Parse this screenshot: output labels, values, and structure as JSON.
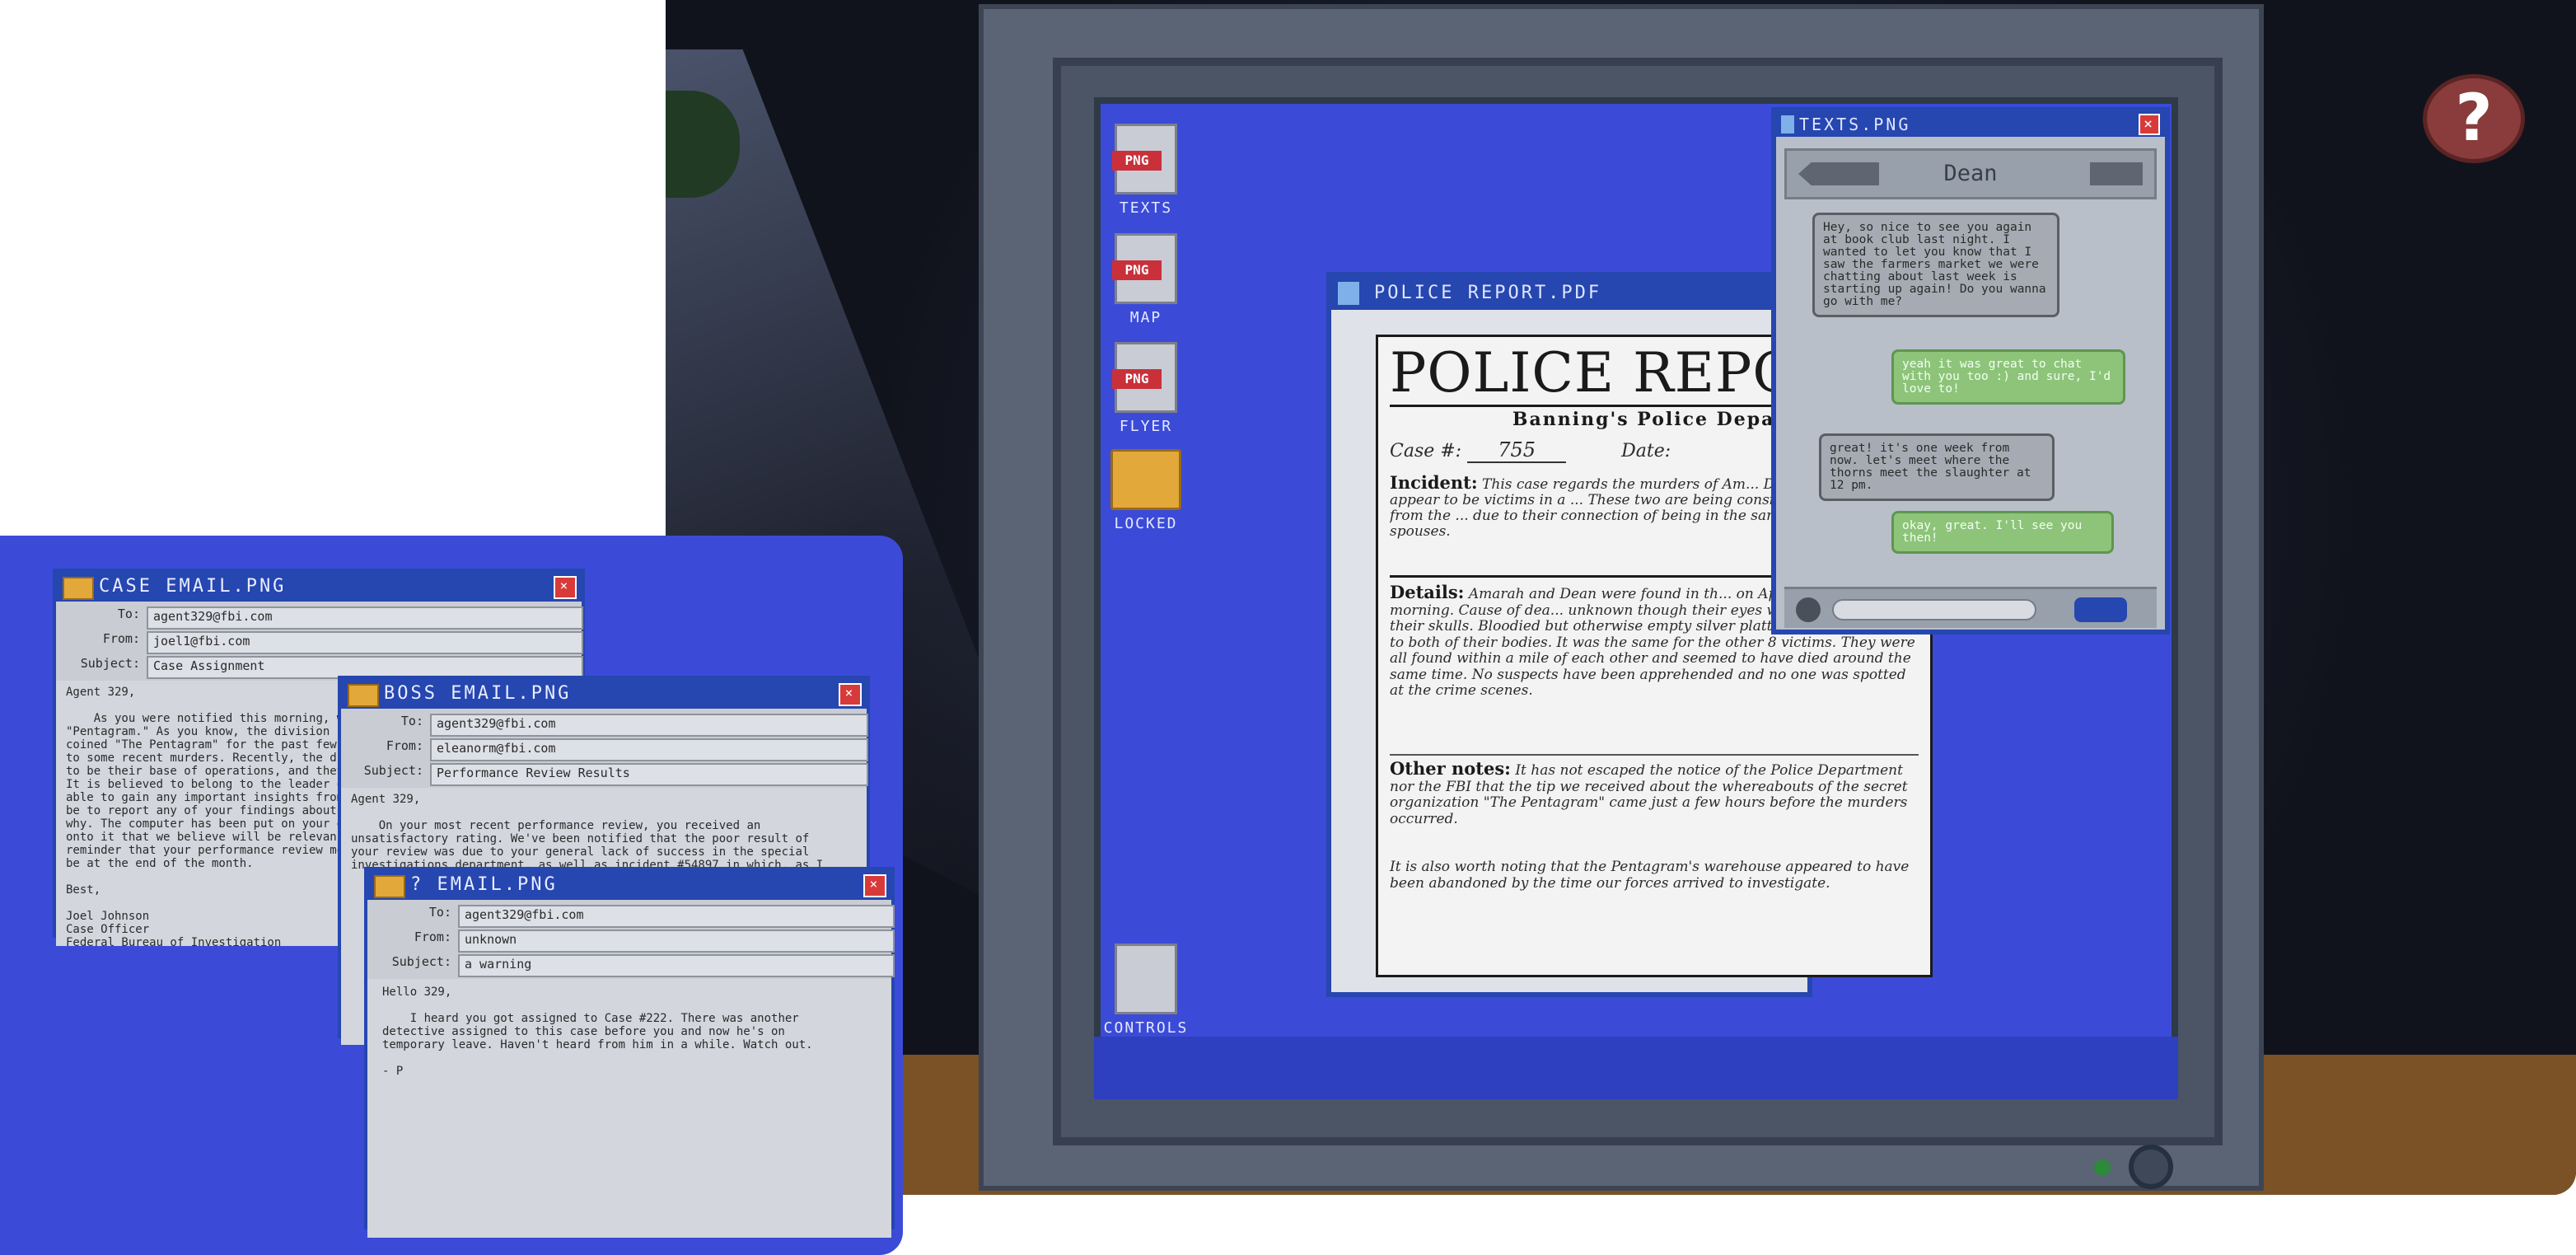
{
  "help": {
    "label": "?"
  },
  "desktop": {
    "icons": [
      {
        "label": "TEXTS",
        "badge": "PNG"
      },
      {
        "label": "MAP",
        "badge": "PNG"
      },
      {
        "label": "FLYER",
        "badge": "PNG"
      },
      {
        "label": "LOCKED"
      },
      {
        "label": "CONTROLS"
      }
    ]
  },
  "report": {
    "title": "POLICE REPORT.PDF",
    "heading": "POLICE REPO",
    "subheading": "Banning's Police Depart",
    "case_label": "Case #:",
    "case_value": "755",
    "date_label": "Date:",
    "incident_label": "Incident:",
    "incident_text": "This case regards the murders of Am... Dean Jamison who appear to be victims in a ... These two are being considered separate from the ... due to their connection of being in the same book ... by their spouses.",
    "details_label": "Details:",
    "details_text": "Amarah and Dean were found in th... on April 29th in the early morning. Cause of dea... unknown though their eyes were missing from their skulls. Bloodied but otherwise empty silver platters were found next to both of their bodies. It was the same for the other 8 victims. They were all found within a mile of each other and seemed to have died around the same time. No suspects have been apprehended and no one was spotted at the crime scenes.",
    "other_label": "Other notes:",
    "other_text": "It has not escaped the notice of the Police Department nor the FBI that the tip we received about the whereabouts of the secret organization \"The Pentagram\" came just a few hours before the murders occurred.",
    "other_text2": "It is also worth noting that the Pentagram's warehouse appeared to have been abandoned by the time our forces arrived to investigate."
  },
  "texts": {
    "title": "TEXTS.PNG",
    "contact": "Dean",
    "messages": [
      {
        "dir": "in",
        "text": "Hey, so nice to see you again at book club last night. I wanted to let you know that I saw the farmers market we were chatting about last week is starting up again! Do you wanna go with me?"
      },
      {
        "dir": "out",
        "text": "yeah it was great to chat with you too :) and sure, I'd love to!"
      },
      {
        "dir": "in",
        "text": "great! it's one week from now. let's meet where the thorns meet the slaughter at 12 pm."
      },
      {
        "dir": "out",
        "text": "okay, great. I'll see you then!"
      }
    ]
  },
  "emails": {
    "case": {
      "title": "CASE EMAIL.PNG",
      "to_label": "To:",
      "to": "agent329@fbi.com",
      "from_label": "From:",
      "from": "joel1@fbi.com",
      "subject_label": "Subject:",
      "subject": "Case Assignment",
      "body": "Agent 329,\n\n    As you were notified this morning, w...\n\"Pentagram.\" As you know, the division has...\ncoined \"The Pentagram\" for the past few mo...\nto some recent murders. Recently, the divi...\nto be their base of operations, and they m...\nIt is believed to belong to the leader of T...\nable to gain any important insights from th...\nbe to report any of your findings about wh...\nwhy. The computer has been put on your desk...\nonto it that we believe will be relevan...\nreminder that your performance review meeti...\nbe at the end of the month.\n\nBest,\n\nJoel Johnson\nCase Officer\nFederal Bureau of Investigation"
    },
    "boss": {
      "title": "BOSS EMAIL.PNG",
      "to_label": "To:",
      "to": "agent329@fbi.com",
      "from_label": "From:",
      "from": "eleanorm@fbi.com",
      "subject_label": "Subject:",
      "subject": "Performance Review Results",
      "body": "Agent 329,\n\n    On your most recent performance review, you received an\nunsatisfactory rating. We've been notified that the poor result of\nyour review was due to your general lack of success in the special\ninvestigations department, as well as incident #54897 in which, as I"
    },
    "unknown": {
      "title": "? EMAIL.PNG",
      "to_label": "To:",
      "to": "agent329@fbi.com",
      "from_label": "From:",
      "from": "unknown",
      "subject_label": "Subject:",
      "subject": "a warning",
      "body": "Hello 329,\n\n    I heard you got assigned to Case #222. There was another\ndetective assigned to this case before you and now he's on\ntemporary leave. Haven't heard from him in a while. Watch out.\n\n- P"
    }
  },
  "colors": {
    "screen": "#3b4bd8",
    "titlebar": "#2646b0",
    "close": "#d83a3a",
    "help": "#8a3b3b"
  }
}
